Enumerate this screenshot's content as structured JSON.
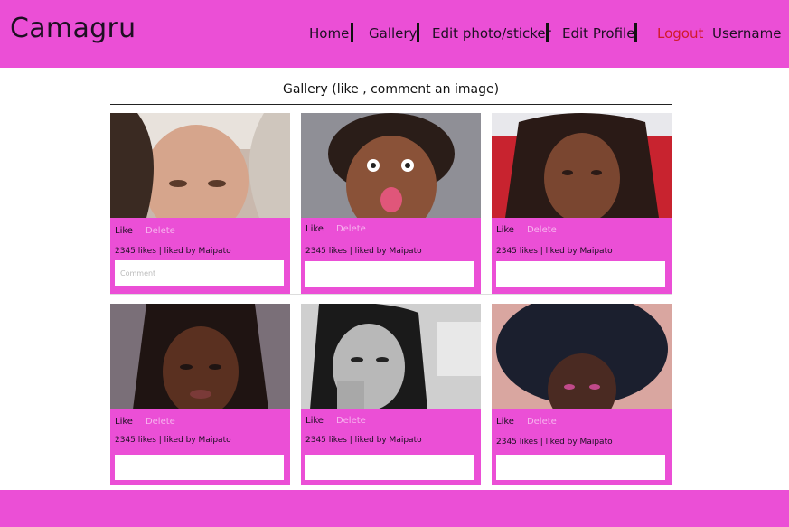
{
  "header": {
    "brand": "Camagru",
    "nav": {
      "home": "Home",
      "gallery": "Gallery",
      "edit_photo": "Edit photo/sticker",
      "edit_profile": "Edit Profile",
      "logout": "Logout",
      "username": "Username"
    }
  },
  "main": {
    "title": "Gallery (like , comment an image)",
    "posts": [
      {
        "like": "Like",
        "delete": "Delete",
        "likes": "2345 likes",
        "liked_by": "| liked by Maipato",
        "comment_placeholder": "Comment"
      },
      {
        "like": "Like",
        "delete": "Delete",
        "likes": "2345 likes",
        "liked_by": "| liked by Maipato",
        "comment_placeholder": ""
      },
      {
        "like": "Like",
        "delete": "Delete",
        "likes": "2345 likes",
        "liked_by": "| liked by Maipato",
        "comment_placeholder": ""
      },
      {
        "like": "Like",
        "delete": "Delete",
        "likes": "2345 likes",
        "liked_by": "| liked by Maipato",
        "comment_placeholder": ""
      },
      {
        "like": "Like",
        "delete": "Delete",
        "likes": "2345 likes",
        "liked_by": "| liked by Maipato",
        "comment_placeholder": ""
      },
      {
        "like": "Like",
        "delete": "Delete",
        "likes": "2345 likes",
        "liked_by": "| liked by Maipato",
        "comment_placeholder": ""
      }
    ]
  },
  "colors": {
    "brand_pink": "#eb4fd6",
    "logout_red": "#d11a2a",
    "delete_light": "#f7b3ee"
  }
}
